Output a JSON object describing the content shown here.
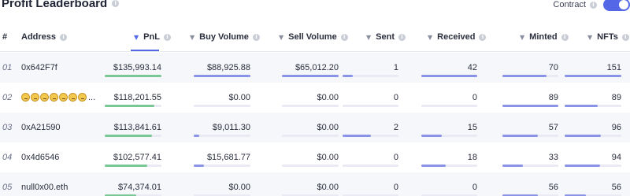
{
  "title": "Profit Leaderboard",
  "contract_label": "Contract",
  "contract_toggle_on": true,
  "columns": {
    "rank": "#",
    "address": "Address",
    "pnl": "PnL",
    "buy_volume": "Buy Volume",
    "sell_volume": "Sell Volume",
    "sent": "Sent",
    "received": "Received",
    "minted": "Minted",
    "nfts": "NFTs"
  },
  "sort_column": "pnl",
  "colors": {
    "accent": "#5468e7",
    "pnl_bar": "#79c795",
    "metric_bar": "#8a93e6",
    "bar_track": "#e9eaf4"
  },
  "rows": [
    {
      "rank": "01",
      "address": "0x642F7f",
      "address_type": "text",
      "pnl": "$135,993.14",
      "buy_volume": "$88,925.88",
      "sell_volume": "$65,012.20",
      "sent": "1",
      "received": "42",
      "minted": "70",
      "nfts": "151",
      "bars": {
        "pnl": 1.0,
        "buy_volume": 1.0,
        "sell_volume": 1.0,
        "sent": 0.18,
        "received": 1.0,
        "minted": 0.79,
        "nfts": 1.0
      }
    },
    {
      "rank": "02",
      "address": "😟😟😟😟😟😟😟...",
      "address_type": "emoji",
      "pnl": "$118,201.55",
      "buy_volume": "$0.00",
      "sell_volume": "$0.00",
      "sent": "0",
      "received": "0",
      "minted": "89",
      "nfts": "89",
      "bars": {
        "pnl": 0.87,
        "buy_volume": 0,
        "sell_volume": 0,
        "sent": 0,
        "received": 0,
        "minted": 1.0,
        "nfts": 0.59
      }
    },
    {
      "rank": "03",
      "address": "0xA21590",
      "address_type": "text",
      "pnl": "$113,841.61",
      "buy_volume": "$9,011.30",
      "sell_volume": "$0.00",
      "sent": "2",
      "received": "15",
      "minted": "57",
      "nfts": "96",
      "bars": {
        "pnl": 0.84,
        "buy_volume": 0.1,
        "sell_volume": 0,
        "sent": 0.5,
        "received": 0.36,
        "minted": 0.64,
        "nfts": 0.64
      }
    },
    {
      "rank": "04",
      "address": "0x4d6546",
      "address_type": "text",
      "pnl": "$102,577.41",
      "buy_volume": "$15,681.77",
      "sell_volume": "$0.00",
      "sent": "0",
      "received": "18",
      "minted": "33",
      "nfts": "94",
      "bars": {
        "pnl": 0.75,
        "buy_volume": 0.18,
        "sell_volume": 0,
        "sent": 0,
        "received": 0.43,
        "minted": 0.37,
        "nfts": 0.62
      }
    },
    {
      "rank": "05",
      "address": "null0x00.eth",
      "address_type": "text",
      "pnl": "$74,374.01",
      "buy_volume": "$0.00",
      "sell_volume": "$0.00",
      "sent": "0",
      "received": "0",
      "minted": "56",
      "nfts": "56",
      "bars": {
        "pnl": 0.55,
        "buy_volume": 0,
        "sell_volume": 0,
        "sent": 0,
        "received": 0,
        "minted": 0.63,
        "nfts": 0.37
      }
    }
  ]
}
